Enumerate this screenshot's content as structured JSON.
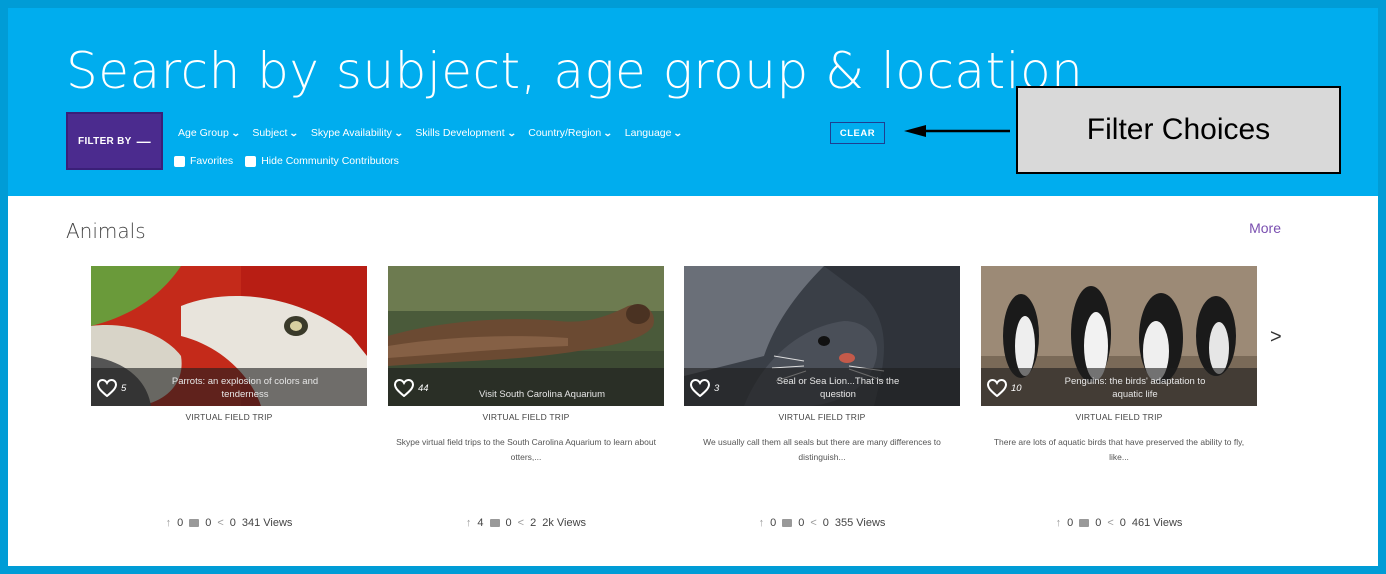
{
  "hero": {
    "title": "Search by subject, age group & location",
    "filter_button": "FILTER BY",
    "filter_dash": "—",
    "filters": [
      {
        "label": "Age Group"
      },
      {
        "label": "Subject"
      },
      {
        "label": "Skype Availability"
      },
      {
        "label": "Skills Development"
      },
      {
        "label": "Country/Region"
      },
      {
        "label": "Language"
      }
    ],
    "clear_label": "CLEAR",
    "checkboxes": [
      {
        "label": "Favorites"
      },
      {
        "label": "Hide Community Contributors"
      }
    ]
  },
  "annotation": {
    "callout_text": "Filter Choices"
  },
  "section": {
    "title": "Animals",
    "more_label": "More",
    "next_label": ">"
  },
  "cards": [
    {
      "likes": "5",
      "caption": "Parrots: an explosion of colors and tenderness",
      "type": "VIRTUAL FIELD TRIP",
      "description": "",
      "upvotes": "0",
      "comments": "0",
      "shares": "0",
      "views": "341 Views"
    },
    {
      "likes": "44",
      "caption": "Visit South Carolina Aquarium",
      "type": "VIRTUAL FIELD TRIP",
      "description": "Skype virtual field trips to the South Carolina Aquarium to learn about otters,...",
      "upvotes": "4",
      "comments": "0",
      "shares": "2",
      "views": "2k Views"
    },
    {
      "likes": "3",
      "caption": "Seal or Sea Lion...That is the question",
      "type": "VIRTUAL FIELD TRIP",
      "description": "We usually call them all seals but there are many differences to distinguish...",
      "upvotes": "0",
      "comments": "0",
      "shares": "0",
      "views": "355 Views"
    },
    {
      "likes": "10",
      "caption": "Penguins: the birds' adaptation to aquatic life",
      "type": "VIRTUAL FIELD TRIP",
      "description": "There are lots of aquatic birds that have preserved the ability to fly, like...",
      "upvotes": "0",
      "comments": "0",
      "shares": "0",
      "views": "461 Views"
    }
  ],
  "icons": {
    "heart": "heart-icon",
    "upvote": "arrow-up-icon",
    "comment": "comment-icon",
    "share": "share-icon",
    "chevron": "chevron-down-icon"
  },
  "colors": {
    "hero_bg": "#00adee",
    "frame_bg": "#009cd6",
    "filter_button_bg": "#4b2b8e",
    "more_link": "#7a4fb0"
  }
}
